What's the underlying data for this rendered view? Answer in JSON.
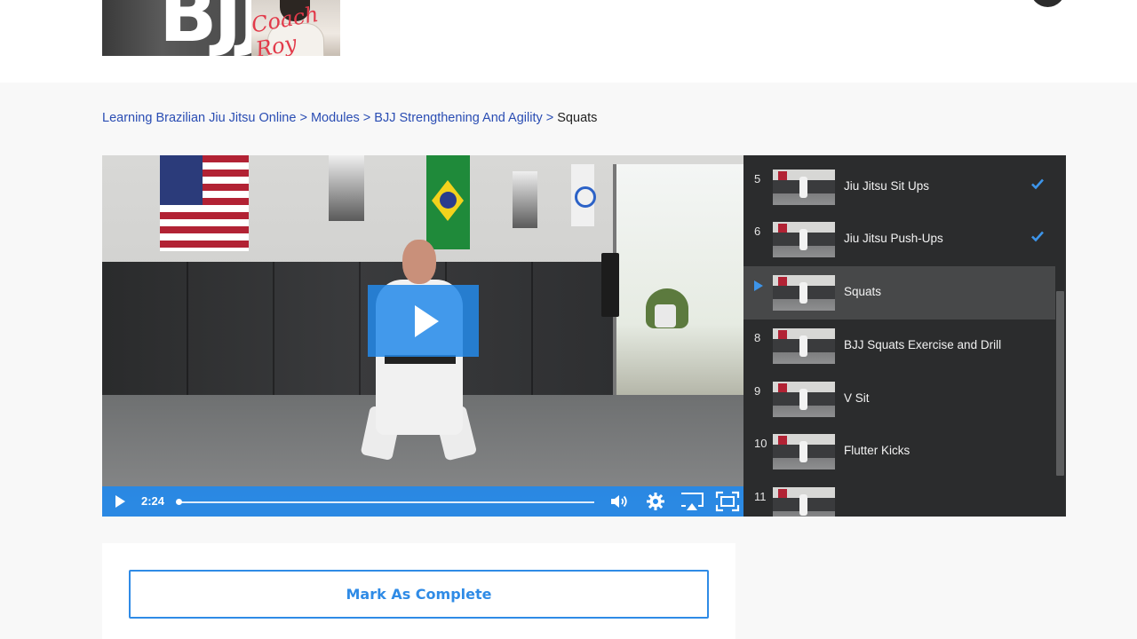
{
  "header": {
    "logo": {
      "text": "BJJ",
      "script": "Coach Roy"
    }
  },
  "breadcrumb": {
    "links": [
      "Learning Brazilian Jiu Jitsu Online",
      "Modules",
      "BJJ Strengthening And Agility"
    ],
    "separator": ">",
    "current": "Squats"
  },
  "player": {
    "time": "2:24",
    "progress": 0.0,
    "icons": [
      "play-icon",
      "volume-icon",
      "settings-icon",
      "airplay-icon",
      "fullscreen-icon"
    ],
    "accent": "#2389ea"
  },
  "playlist": {
    "items": [
      {
        "num": "",
        "title": "",
        "completed": false,
        "active": false
      },
      {
        "num": "5",
        "title": "Jiu Jitsu Sit Ups",
        "completed": true,
        "active": false
      },
      {
        "num": "6",
        "title": "Jiu Jitsu Push-Ups",
        "completed": true,
        "active": false
      },
      {
        "num": "",
        "title": "Squats",
        "completed": false,
        "active": true
      },
      {
        "num": "8",
        "title": "BJJ Squats Exercise and Drill",
        "completed": false,
        "active": false
      },
      {
        "num": "9",
        "title": "V Sit",
        "completed": false,
        "active": false
      },
      {
        "num": "10",
        "title": "Flutter Kicks",
        "completed": false,
        "active": false
      },
      {
        "num": "11",
        "title": "",
        "completed": false,
        "active": false
      }
    ],
    "check_color": "#3d95ea",
    "active_bg": "#474849"
  },
  "actions": {
    "mark_complete": "Mark As Complete"
  }
}
